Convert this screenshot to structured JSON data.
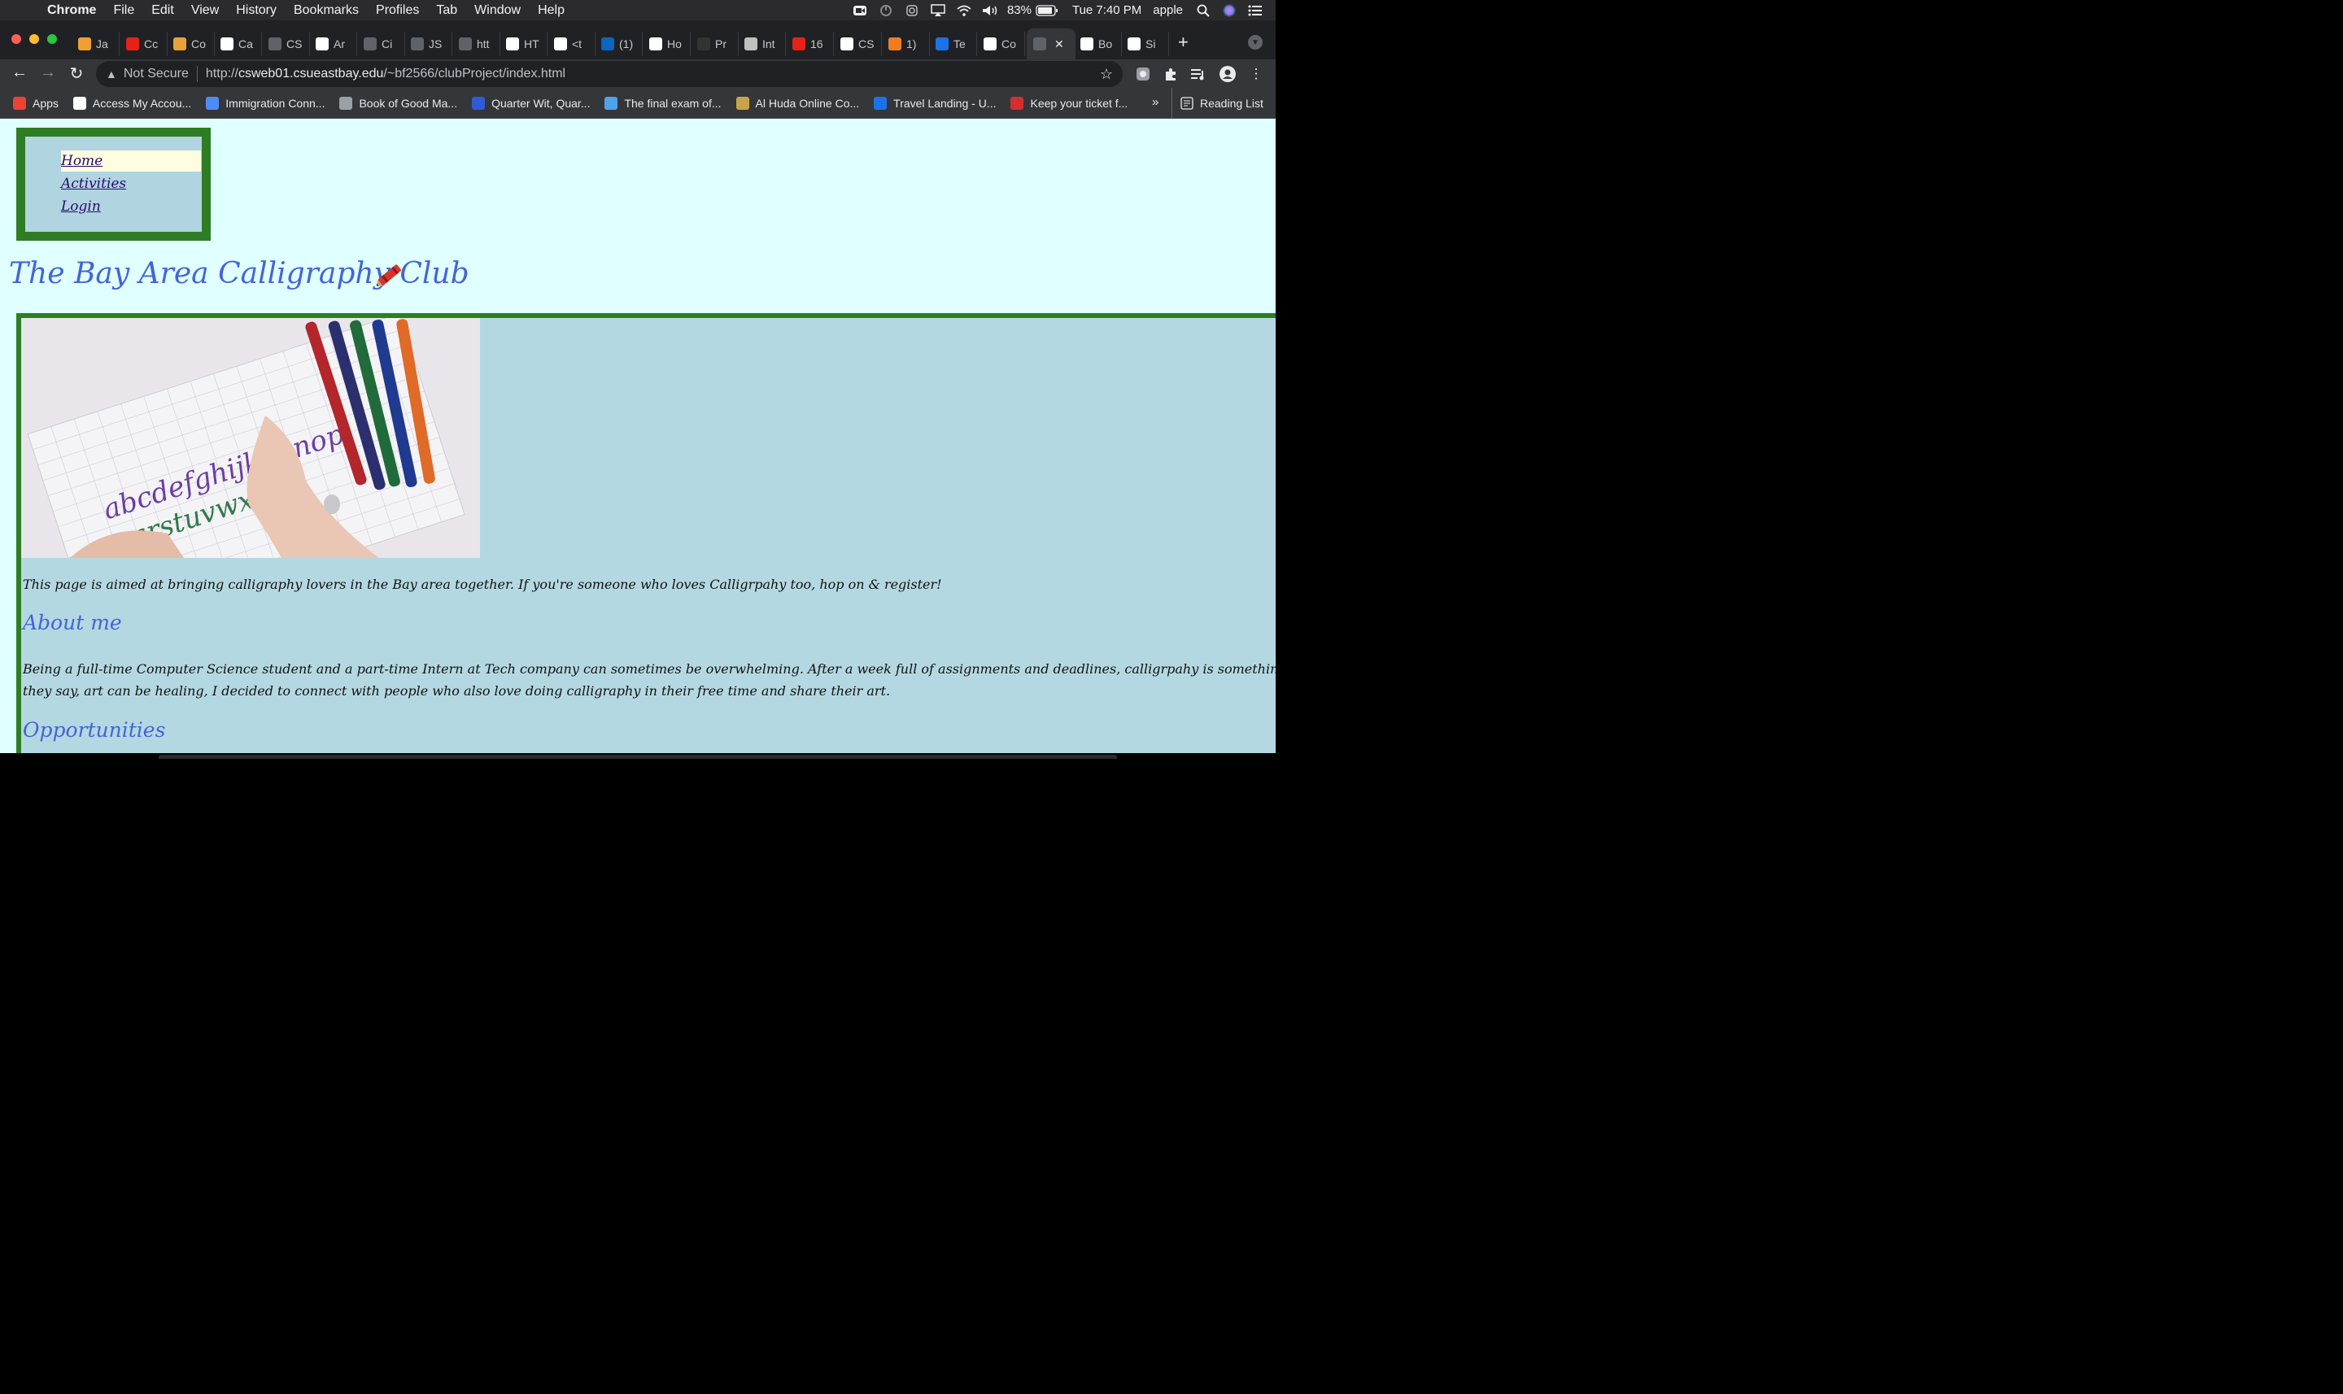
{
  "menubar": {
    "app": "Chrome",
    "menus": [
      "File",
      "Edit",
      "View",
      "History",
      "Bookmarks",
      "Profiles",
      "Tab",
      "Window",
      "Help"
    ],
    "battery": "83%",
    "clock": "Tue 7:40 PM",
    "user": "apple"
  },
  "tabs": [
    {
      "label": "Ja",
      "icon": "java-icon",
      "color": "#f0a030"
    },
    {
      "label": "Cc",
      "icon": "youtube-icon",
      "color": "#e62117"
    },
    {
      "label": "Co",
      "icon": "pencil-icon",
      "color": "#e8a23a"
    },
    {
      "label": "Ca",
      "icon": "eb-icon",
      "color": "#ffffff"
    },
    {
      "label": "CS",
      "icon": "globe-icon",
      "color": "#5f6368"
    },
    {
      "label": "Ar",
      "icon": "mortarboard-icon",
      "color": "#ffffff"
    },
    {
      "label": "Ci",
      "icon": "globe-icon",
      "color": "#5f6368"
    },
    {
      "label": "JS",
      "icon": "globe-icon",
      "color": "#5f6368"
    },
    {
      "label": "htt",
      "icon": "globe-icon",
      "color": "#5f6368"
    },
    {
      "label": "HT",
      "icon": "mortarboard-icon",
      "color": "#ffffff"
    },
    {
      "label": "<t",
      "icon": "mortarboard-icon",
      "color": "#ffffff"
    },
    {
      "label": "(1)",
      "icon": "linkedin-icon",
      "color": "#0a66c2"
    },
    {
      "label": "Ho",
      "icon": "medium-icon",
      "color": "#ffffff"
    },
    {
      "label": "Pr",
      "icon": "dark-globe-icon",
      "color": "#333333"
    },
    {
      "label": "Int",
      "icon": "book-icon",
      "color": "#c0c0c0"
    },
    {
      "label": "16",
      "icon": "youtube-icon",
      "color": "#e62117"
    },
    {
      "label": "CS",
      "icon": "github-icon",
      "color": "#ffffff"
    },
    {
      "label": "1)",
      "icon": "c-icon",
      "color": "#f07c22"
    },
    {
      "label": "Te",
      "icon": "funnel-icon",
      "color": "#1a73e8"
    },
    {
      "label": "Co",
      "icon": "github-icon",
      "color": "#ffffff"
    },
    {
      "label": "",
      "icon": "globe-icon",
      "color": "#5f6368",
      "active": true
    },
    {
      "label": "Bo",
      "icon": "google-icon",
      "color": "#ffffff"
    },
    {
      "label": "Si",
      "icon": "google-icon",
      "color": "#ffffff"
    }
  ],
  "omnibox": {
    "security": "Not Secure",
    "scheme": "http://",
    "host": "csweb01.csueastbay.edu",
    "path": "/~bf2566/clubProject/index.html"
  },
  "bookmarks": [
    {
      "label": "Apps",
      "icon": "apps-grid-icon",
      "color": "#ea4335"
    },
    {
      "label": "Access My Accou...",
      "icon": "x-icon",
      "color": "#ffffff"
    },
    {
      "label": "Immigration Conn...",
      "icon": "circle-icon",
      "color": "#4f8df5"
    },
    {
      "label": "Book of Good Ma...",
      "icon": "badge-icon",
      "color": "#9aa0a6"
    },
    {
      "label": "Quarter Wit, Quar...",
      "icon": "shield-icon",
      "color": "#2f5bd8"
    },
    {
      "label": "The final exam of...",
      "icon": "people-icon",
      "color": "#4fa3e8"
    },
    {
      "label": "Al Huda Online Co...",
      "icon": "coin-icon",
      "color": "#c9a34b"
    },
    {
      "label": "Travel Landing - U...",
      "icon": "frame-icon",
      "color": "#1a73e8"
    },
    {
      "label": "Keep your ticket f...",
      "icon": "ek-icon",
      "color": "#d32f2f"
    }
  ],
  "bookmarks_more": "»",
  "reading_list": "Reading List",
  "page": {
    "nav": [
      "Home",
      "Activities",
      "Login"
    ],
    "title": "The Bay Area Calligraphy Club",
    "intro": "This page is aimed at bringing calligraphy lovers in the Bay area together. If you're someone who loves Calligrpahy too, hop on & register!",
    "about_heading": "About me",
    "about_line1": "Being a full-time Computer Science student and a part-time Intern at Tech company can sometimes be overwhelming. After a week full of assignments and deadlines, calligrpahy is something that I look forward to over the",
    "about_line2": "they say, art can be healing, I decided to connect with people who also love doing calligraphy in their free time and share their art.",
    "opportunities_heading": "Opportunities",
    "image_text_1": "abcdefghijklmnop",
    "image_text_2": "qrstuvwxyz"
  }
}
